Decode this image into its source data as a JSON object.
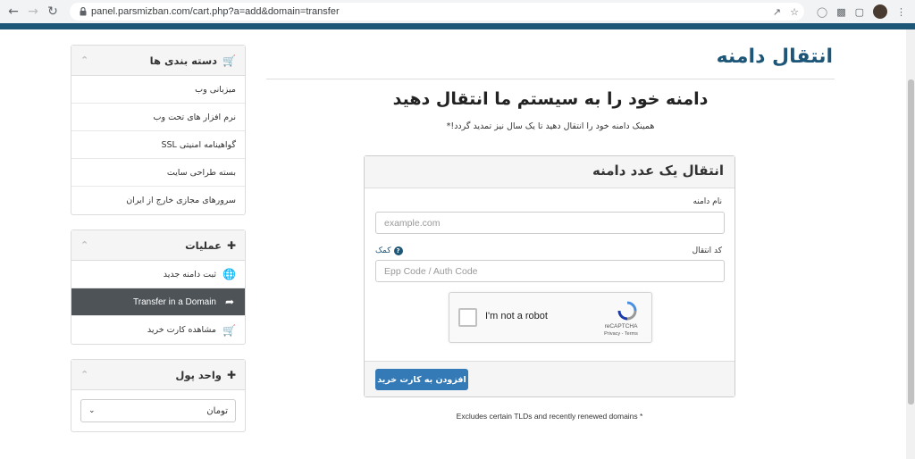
{
  "browser": {
    "url": "panel.parsmizban.com/cart.php?a=add&domain=transfer"
  },
  "page": {
    "title": "انتقال دامنه",
    "headline": "دامنه خود را به سیستم ما انتقال دهید",
    "subheadline": "همینک دامنه خود را انتقال دهید تا یک سال نیز تمدید گردد!*",
    "footnote": "* Excludes certain TLDs and recently renewed domains"
  },
  "sidebar": {
    "categories": {
      "title": "دسته بندی ها",
      "items": [
        {
          "label": "میزبانی وب"
        },
        {
          "label": "نرم افزار های تحت وب"
        },
        {
          "label": "گواهینامه امنیتی SSL"
        },
        {
          "label": "بسته طراحی سایت"
        },
        {
          "label": "سرورهای مجازی خارج از ایران"
        }
      ]
    },
    "actions": {
      "title": "عملیات",
      "items": [
        {
          "label": "ثبت دامنه جدید",
          "icon": "globe-icon"
        },
        {
          "label": "Transfer in a Domain",
          "icon": "share-arrow-icon",
          "active": true
        },
        {
          "label": "مشاهده کارت خرید",
          "icon": "cart-icon"
        }
      ]
    },
    "currency": {
      "title": "واحد پول",
      "selected": "تومان"
    }
  },
  "form": {
    "card_title": "انتقال یک عدد دامنه",
    "domain_label": "نام دامنه",
    "domain_placeholder": "example.com",
    "epp_label": "کد انتقال",
    "epp_placeholder": "Epp Code / Auth Code",
    "help_label": "کمک",
    "captcha_text": "I'm not a robot",
    "captcha_brand": "reCAPTCHA",
    "captcha_links": "Privacy - Terms",
    "submit_label": "افزودن به کارت خرید"
  },
  "colors": {
    "brand": "#1e5678",
    "button": "#337ab7",
    "active_item": "#4d5357"
  }
}
